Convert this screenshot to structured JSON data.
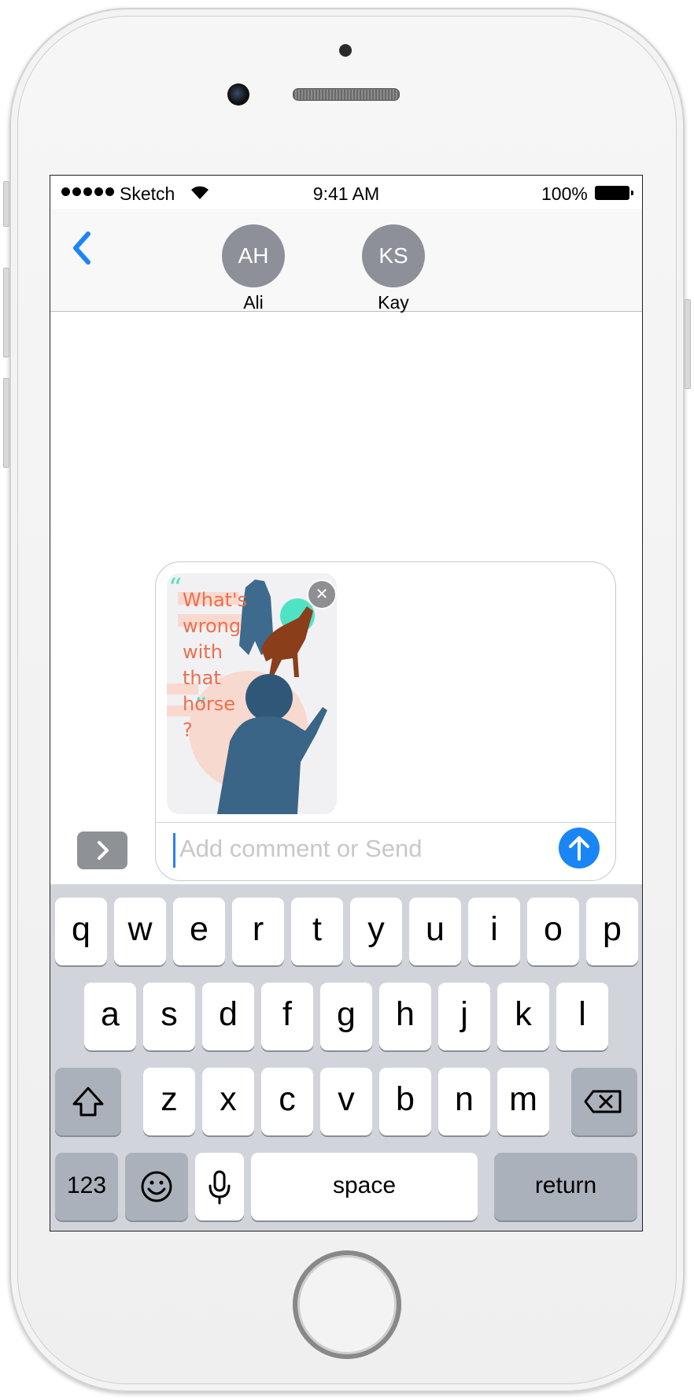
{
  "status_bar": {
    "carrier": "Sketch",
    "time": "9:41 AM",
    "battery": "100%"
  },
  "nav": {
    "contacts": [
      {
        "initials": "AH",
        "name": "Ali"
      },
      {
        "initials": "KS",
        "name": "Kay"
      }
    ]
  },
  "compose": {
    "sticker_text": [
      "What's",
      "wrong",
      "with",
      "that",
      "horse",
      "?"
    ],
    "placeholder": "Add comment or Send"
  },
  "keyboard": {
    "row1": [
      "q",
      "w",
      "e",
      "r",
      "t",
      "y",
      "u",
      "i",
      "o",
      "p"
    ],
    "row2": [
      "a",
      "s",
      "d",
      "f",
      "g",
      "h",
      "j",
      "k",
      "l"
    ],
    "row3": [
      "z",
      "x",
      "c",
      "v",
      "b",
      "n",
      "m"
    ],
    "numbers_label": "123",
    "space_label": "space",
    "return_label": "return"
  },
  "colors": {
    "accent": "#1a86f5",
    "avatar_bg": "#8d9099",
    "keyboard_bg": "#d1d5db",
    "sticker_text": "#ee6f4c"
  }
}
